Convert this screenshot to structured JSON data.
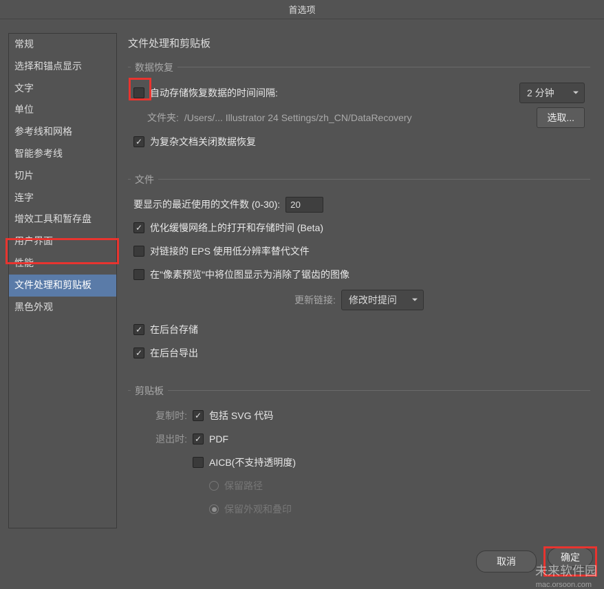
{
  "window": {
    "title": "首选项"
  },
  "sidebar": {
    "items": [
      {
        "label": "常规"
      },
      {
        "label": "选择和锚点显示"
      },
      {
        "label": "文字"
      },
      {
        "label": "单位"
      },
      {
        "label": "参考线和网格"
      },
      {
        "label": "智能参考线"
      },
      {
        "label": "切片"
      },
      {
        "label": "连字"
      },
      {
        "label": "增效工具和暂存盘"
      },
      {
        "label": "用户界面"
      },
      {
        "label": "性能"
      },
      {
        "label": "文件处理和剪贴板"
      },
      {
        "label": "黑色外观"
      }
    ]
  },
  "page": {
    "title": "文件处理和剪贴板"
  },
  "dataRecovery": {
    "title": "数据恢复",
    "auto_save_label": "自动存储恢复数据的时间间隔:",
    "interval": "2 分钟",
    "folder_label": "文件夹:",
    "folder_path": "/Users/... Illustrator 24 Settings/zh_CN/DataRecovery",
    "choose_label": "选取...",
    "turn_off_label": "为复杂文档关闭数据恢复"
  },
  "files": {
    "title": "文件",
    "recent_label": "要显示的最近使用的文件数 (0-30):",
    "recent_value": "20",
    "optimize_label": "优化缓慢网络上的打开和存储时间 (Beta)",
    "eps_label": "对链接的 EPS 使用低分辨率替代文件",
    "pixel_label": "在\"像素预览\"中将位图显示为消除了锯齿的图像",
    "update_links_label": "更新链接:",
    "update_links_value": "修改时提问",
    "bg_save_label": "在后台存储",
    "bg_export_label": "在后台导出"
  },
  "clipboard": {
    "title": "剪贴板",
    "copy_label": "复制时:",
    "svg_label": "包括 SVG 代码",
    "quit_label": "退出时:",
    "pdf_label": "PDF",
    "aicb_label": "AICB(不支持透明度)",
    "preserve_paths_label": "保留路径",
    "preserve_appearance_label": "保留外观和叠印"
  },
  "footer": {
    "cancel": "取消",
    "ok": "确定"
  },
  "watermark": {
    "main": "未来软件园",
    "sub": "mac.orsoon.com"
  }
}
